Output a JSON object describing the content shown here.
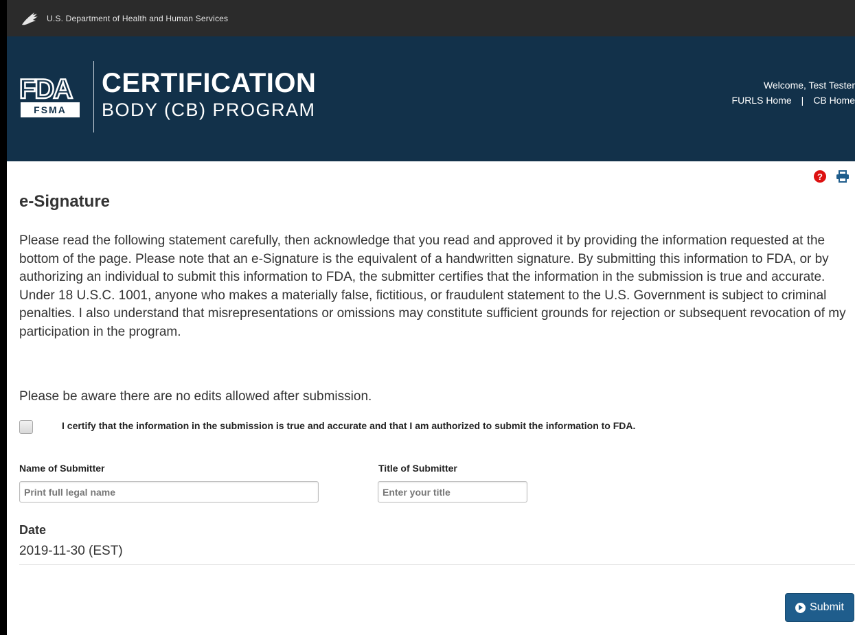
{
  "top_bar": {
    "agency": "U.S. Department of Health and Human Services",
    "icon": "hhs-eagle-icon"
  },
  "header": {
    "logo_text": "FDA",
    "logo_subtext": "FSMA",
    "title_main": "CERTIFICATION",
    "title_sub": "BODY (CB) PROGRAM",
    "welcome": "Welcome, Test Tester",
    "links": [
      {
        "label": "FURLS Home"
      },
      {
        "label": "CB Home"
      }
    ],
    "background_color": "#12314a"
  },
  "toolbar": {
    "help_icon": "question-circle-icon",
    "print_icon": "print-icon"
  },
  "page": {
    "title": "e-Signature",
    "statement": "Please read the following statement carefully, then acknowledge that you read and approved it by providing the information requested at the bottom of the page. Please note that an e-Signature is the equivalent of a handwritten signature. By submitting this information to FDA, or by authorizing an individual to submit this information to FDA, the submitter certifies that the information in the submission is true and accurate. Under 18 U.S.C. 1001, anyone who makes a materially false, fictitious, or fraudulent statement to the U.S. Government is subject to criminal penalties. I also understand that misrepresentations or omissions may constitute sufficient grounds for rejection or subsequent revocation of my participation in the program.",
    "aware_note": "Please be aware there are no edits allowed after submission.",
    "certify_label": "I certify that the information in the submission is true and accurate and that I am authorized to submit the information to FDA.",
    "certify_checked": false
  },
  "form": {
    "name_label": "Name of Submitter",
    "name_placeholder": "Print full legal name",
    "name_value": "",
    "title_label": "Title of Submitter",
    "title_placeholder": "Enter your title",
    "title_value": ""
  },
  "date": {
    "label": "Date",
    "value": "2019-11-30  (EST)"
  },
  "actions": {
    "submit_label": "Submit",
    "submit_color": "#1f5d8c"
  }
}
